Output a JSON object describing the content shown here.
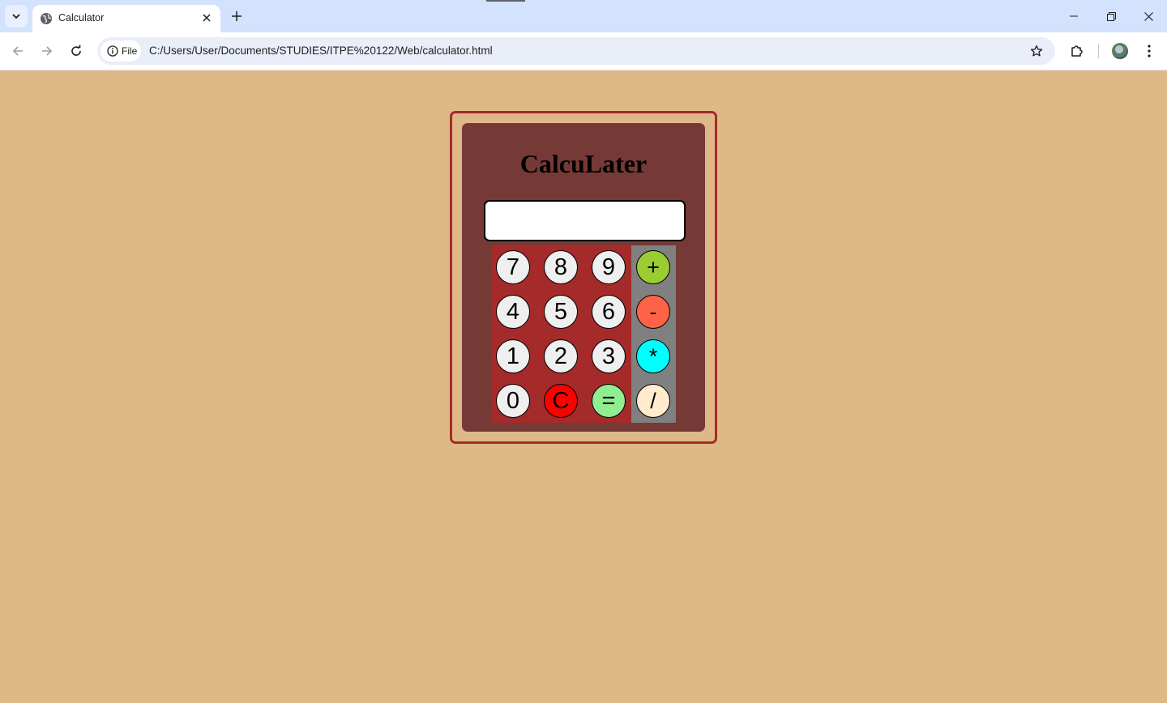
{
  "browser": {
    "tab_title": "Calculator",
    "site_chip_label": "File",
    "url": "C:/Users/User/Documents/STUDIES/ITPE%20122/Web/calculator.html"
  },
  "calculator": {
    "title": "CalcuLater",
    "display_value": "",
    "number_keys": [
      {
        "label": "7",
        "color": "#efefef"
      },
      {
        "label": "8",
        "color": "#efefef"
      },
      {
        "label": "9",
        "color": "#efefef"
      },
      {
        "label": "4",
        "color": "#efefef"
      },
      {
        "label": "5",
        "color": "#efefef"
      },
      {
        "label": "6",
        "color": "#efefef"
      },
      {
        "label": "1",
        "color": "#efefef"
      },
      {
        "label": "2",
        "color": "#efefef"
      },
      {
        "label": "3",
        "color": "#efefef"
      },
      {
        "label": "0",
        "color": "#efefef"
      },
      {
        "label": "C",
        "color": "#ff0000"
      },
      {
        "label": "=",
        "color": "#90ee90"
      }
    ],
    "operator_keys": [
      {
        "label": "+",
        "color": "#9acd32"
      },
      {
        "label": "-",
        "color": "#ff6347"
      },
      {
        "label": "*",
        "color": "#00ffff"
      },
      {
        "label": "/",
        "color": "#ffebcd"
      }
    ],
    "colors": {
      "page_background": "#deb887",
      "outer_border": "#a52a2a",
      "body": "#763a36",
      "keypad": "#a52a2a",
      "operator_pad": "#808080"
    }
  }
}
